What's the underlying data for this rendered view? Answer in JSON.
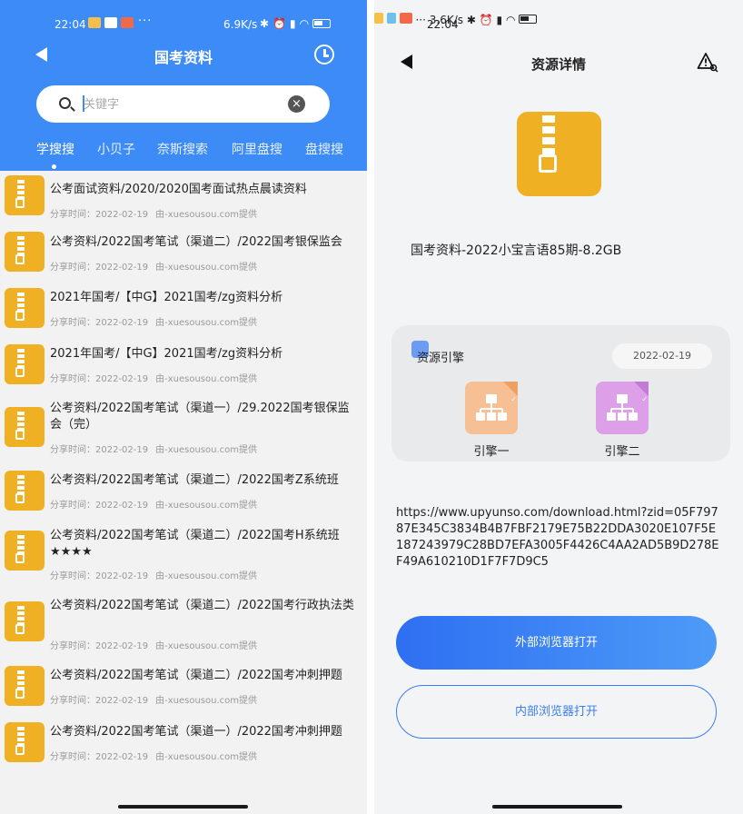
{
  "left": {
    "status": {
      "time": "22:04",
      "net_speed": "6.9K/s"
    },
    "title": "国考资料",
    "search": {
      "placeholder": "关键字"
    },
    "tabs": [
      {
        "label": "学搜搜",
        "active": true
      },
      {
        "label": "小贝子",
        "active": false
      },
      {
        "label": "奈斯搜索",
        "active": false
      },
      {
        "label": "阿里盘搜",
        "active": false
      },
      {
        "label": "盘搜搜",
        "active": false
      }
    ],
    "items": [
      {
        "title": "公考面试资料/2020/2020国考面试热点晨读资料",
        "date": "分享时间：2022-02-19",
        "source": "由-xuesousou.com提供"
      },
      {
        "title": "公考资料/2022国考笔试（渠道二）/2022国考银保监会",
        "date": "分享时间：2022-02-19",
        "source": "由-xuesousou.com提供"
      },
      {
        "title": "2021年国考/【中G】2021国考/zg资料分析",
        "date": "分享时间：2022-02-19",
        "source": "由-xuesousou.com提供"
      },
      {
        "title": "2021年国考/【中G】2021国考/zg资料分析",
        "date": "分享时间：2022-02-19",
        "source": "由-xuesousou.com提供"
      },
      {
        "title": "公考资料/2022国考笔试（渠道一）/29.2022国考银保监会（完）",
        "date": "分享时间：2022-02-19",
        "source": "由-xuesousou.com提供"
      },
      {
        "title": "公考资料/2022国考笔试（渠道二）/2022国考Z系统班",
        "date": "分享时间：2022-02-19",
        "source": "由-xuesousou.com提供"
      },
      {
        "title": "公考资料/2022国考笔试（渠道二）/2022国考H系统班★★★★",
        "date": "分享时间：2022-02-19",
        "source": "由-xuesousou.com提供"
      },
      {
        "title": "公考资料/2022国考笔试（渠道二）/2022国考行政执法类",
        "date": "分享时间：2022-02-19",
        "source": "由-xuesousou.com提供"
      },
      {
        "title": "公考资料/2022国考笔试（渠道二）/2022国考冲刺押题",
        "date": "分享时间：2022-02-19",
        "source": "由-xuesousou.com提供"
      },
      {
        "title": "公考资料/2022国考笔试（渠道一）/2022国考冲刺押题",
        "date": "分享时间：2022-02-19",
        "source": "由-xuesousou.com提供"
      }
    ]
  },
  "right": {
    "status": {
      "time": "22:04",
      "net_speed": "3.6K/s"
    },
    "title": "资源详情",
    "resource_name": "国考资料-2022小宝言语85期-8.2GB",
    "engine_section": {
      "title": "资源引擎",
      "date": "2022-02-19",
      "engines": [
        {
          "label": "引擎一",
          "color": "#f6bf94",
          "accent": "#f0a060"
        },
        {
          "label": "引擎二",
          "color": "#dc9fe8",
          "accent": "#c27ad6"
        }
      ]
    },
    "url": "https://www.upyunso.com/download.html?zid=05F79787E345C3834B4B7FBF2179E75B22DDA3020E107F5E187243979C28BD7EFA3005F4426C4AA2AD5B9D278EF49A610210D1F7F7D9C5",
    "buttons": {
      "external": "外部浏览器打开",
      "internal": "内部浏览器打开"
    }
  },
  "colors": {
    "header_blue": "#3d8bf6",
    "zip_yellow": "#f0b023",
    "button_blue": "#2e6ff2"
  }
}
